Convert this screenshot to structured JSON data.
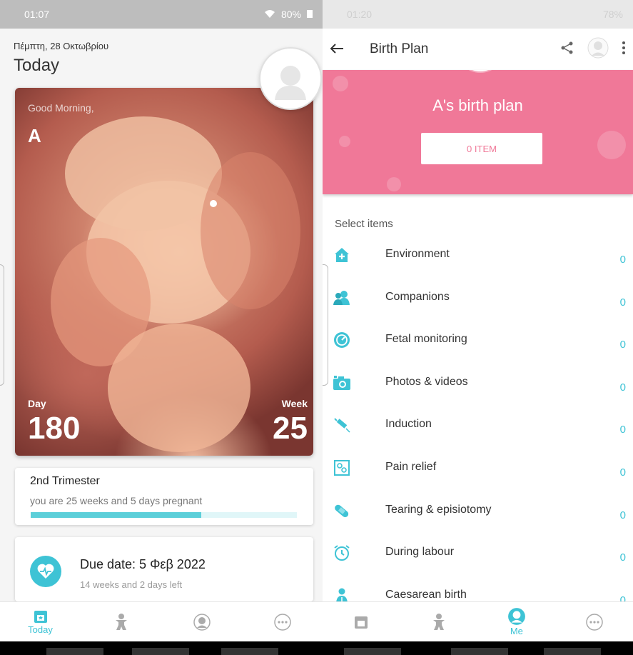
{
  "left_screen": {
    "status": {
      "time": "01:07",
      "battery": "80%"
    },
    "date": "Πέμπτη, 28 Οκτωβρίου",
    "title": "Today",
    "hero": {
      "greeting": "Good Morning,",
      "name": "A",
      "day_label": "Day",
      "day_value": "180",
      "week_label": "Week",
      "week_value": "25"
    },
    "trimester": {
      "title": "2nd Trimester",
      "subtitle": "you are 25 weeks and 5 days pregnant",
      "progress": 0.64
    },
    "due": {
      "title": "Due date: 5 Φεβ 2022",
      "subtitle": "14 weeks and 2 days left"
    },
    "nav": [
      {
        "label": "Today",
        "icon": "calendar-icon",
        "active": true
      },
      {
        "label": "",
        "icon": "baby-icon",
        "active": false
      },
      {
        "label": "",
        "icon": "profile-icon",
        "active": false
      },
      {
        "label": "",
        "icon": "more-icon",
        "active": false
      }
    ]
  },
  "right_screen": {
    "status": {
      "time": "01:20",
      "battery": "78%"
    },
    "toolbar": {
      "title": "Birth Plan"
    },
    "banner": {
      "title": "A's birth plan",
      "button": "0 ITEM"
    },
    "select_label": "Select items",
    "items": [
      {
        "label": "Environment",
        "count": "0",
        "icon": "house-plus-icon"
      },
      {
        "label": "Companions",
        "count": "0",
        "icon": "companions-icon"
      },
      {
        "label": "Fetal monitoring",
        "count": "0",
        "icon": "gauge-icon"
      },
      {
        "label": "Photos & videos",
        "count": "0",
        "icon": "camera-icon"
      },
      {
        "label": "Induction",
        "count": "0",
        "icon": "syringe-icon"
      },
      {
        "label": "Pain relief",
        "count": "0",
        "icon": "pain-relief-icon"
      },
      {
        "label": "Tearing & episiotomy",
        "count": "0",
        "icon": "bandage-icon"
      },
      {
        "label": "During labour",
        "count": "0",
        "icon": "alarm-clock-icon"
      },
      {
        "label": "Caesarean birth",
        "count": "0",
        "icon": "doctor-icon"
      }
    ],
    "nav": [
      {
        "label": "",
        "icon": "calendar-icon",
        "active": false
      },
      {
        "label": "",
        "icon": "baby-icon",
        "active": false
      },
      {
        "label": "Me",
        "icon": "profile-icon",
        "active": true
      },
      {
        "label": "",
        "icon": "more-icon",
        "active": false
      }
    ]
  },
  "colors": {
    "accent": "#3ec3d5",
    "pink": "#f07898"
  }
}
